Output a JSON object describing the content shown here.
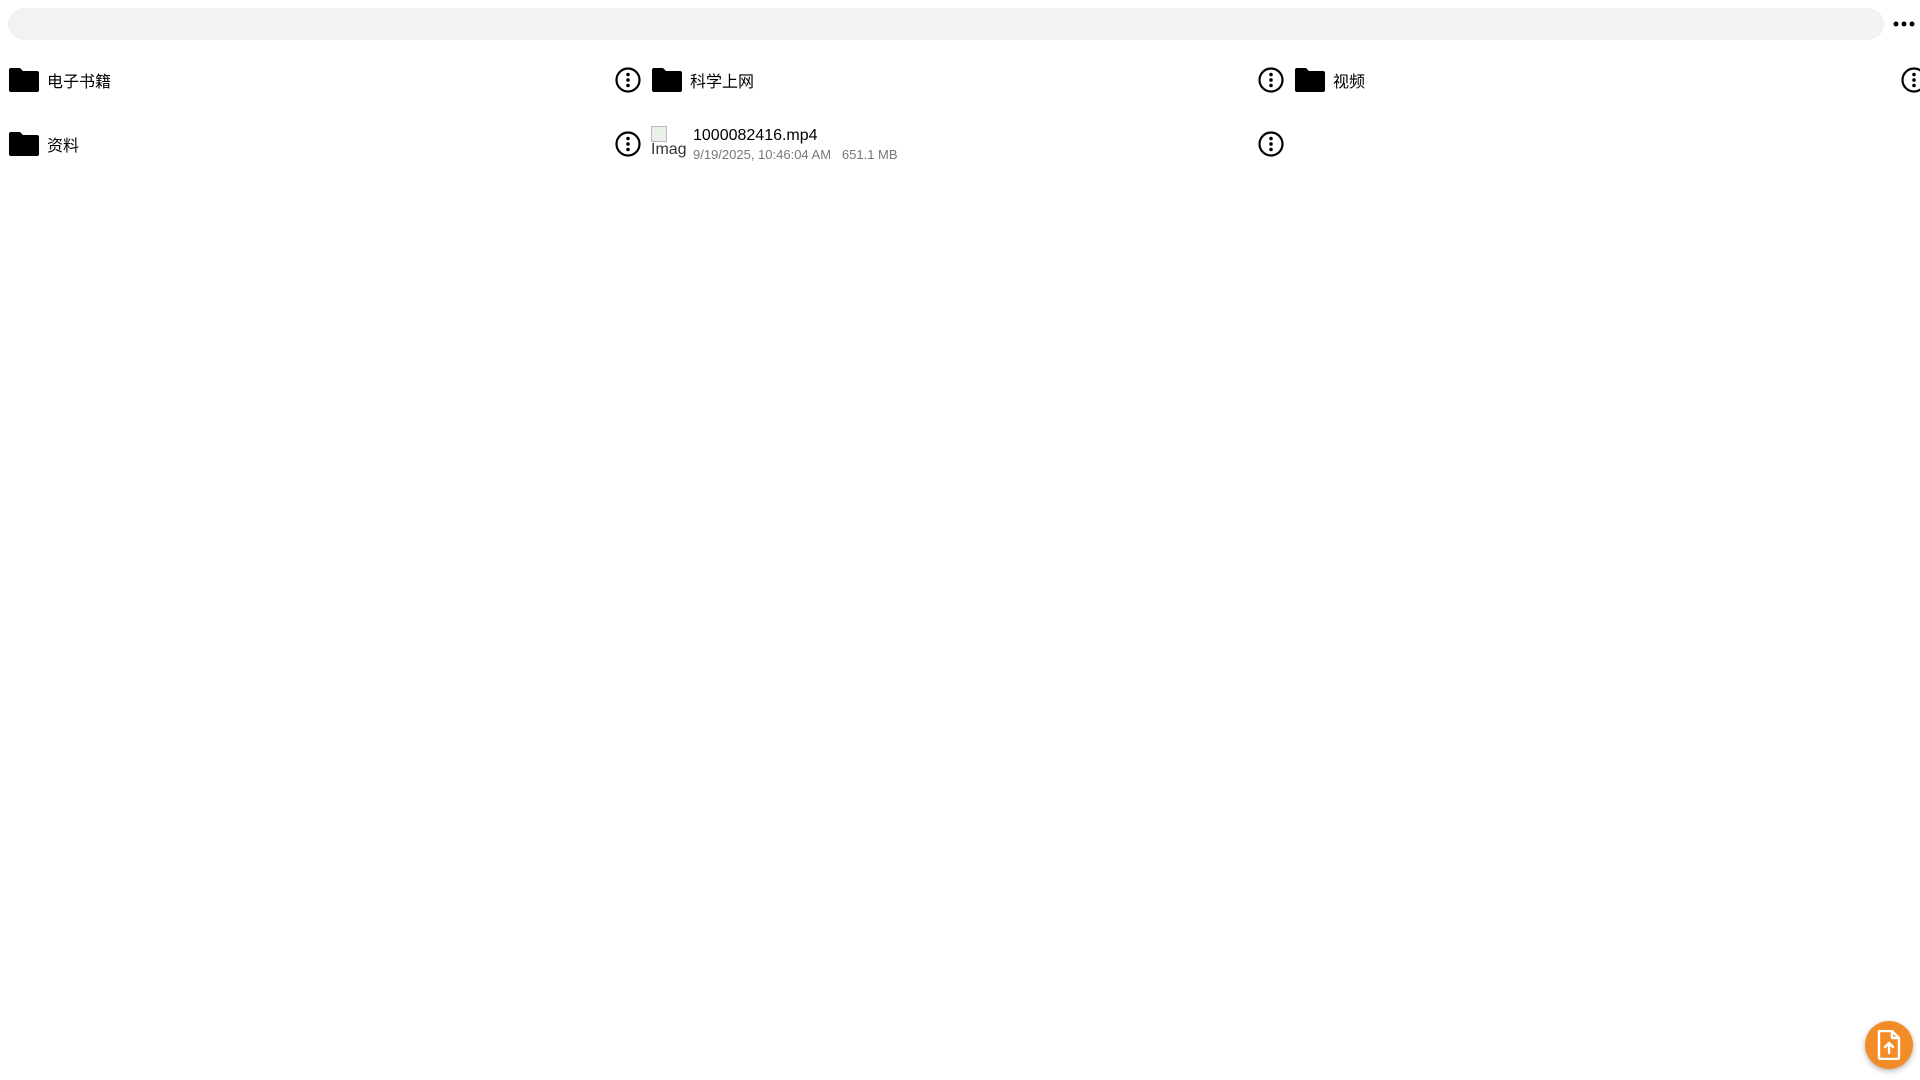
{
  "header": {
    "path": "",
    "more_icon": "more-horizontal-icon"
  },
  "items": [
    {
      "type": "folder",
      "name": "电子书籍",
      "icon": "folder-icon",
      "menu_icon": "more-vertical-icon"
    },
    {
      "type": "folder",
      "name": "科学上网",
      "icon": "folder-icon",
      "menu_icon": "more-vertical-icon"
    },
    {
      "type": "folder",
      "name": "视频",
      "icon": "folder-icon",
      "menu_icon": "more-vertical-icon"
    },
    {
      "type": "folder",
      "name": "资料",
      "icon": "folder-icon",
      "menu_icon": "more-vertical-icon"
    },
    {
      "type": "file",
      "name": "1000082416.mp4",
      "thumb_alt": "Image",
      "modified": "9/19/2025, 10:46:04 AM",
      "size": "651.1 MB",
      "menu_icon": "more-vertical-icon"
    }
  ],
  "fab": {
    "icon": "upload-file-icon",
    "color": "#f28c28"
  },
  "colors": {
    "pathbar_bg": "#f2f2f2",
    "accent": "#f28c28",
    "meta_text": "#777777"
  }
}
